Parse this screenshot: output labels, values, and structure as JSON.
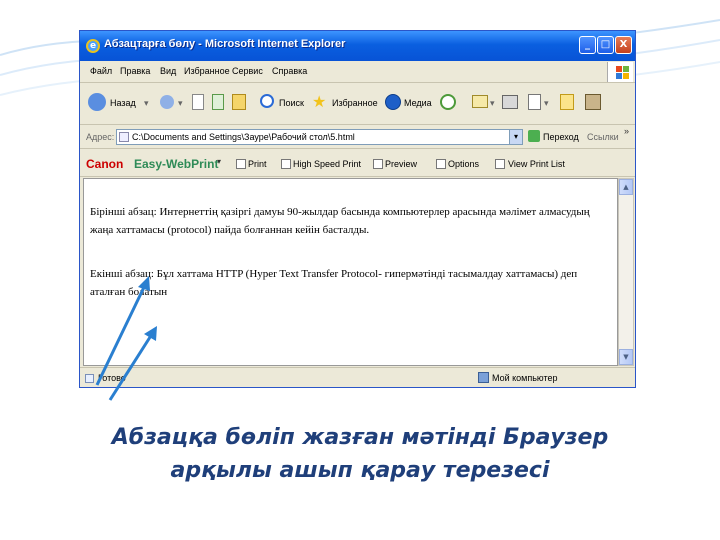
{
  "colors": {
    "caption": "#1f3f7a",
    "arrows": "#2a7fd0",
    "titlebar": "#0a5fe0"
  },
  "window": {
    "title": "Абзацтарға бөлу - Microsoft Internet Explorer",
    "icon": "ie-icon",
    "controls": [
      "_",
      "□",
      "X"
    ]
  },
  "menu": [
    "Файл",
    "Правка",
    "Вид",
    "Избранное",
    "Сервис",
    "Справка"
  ],
  "toolbar": {
    "back": "Назад",
    "search": "Поиск",
    "favorites": "Избранное",
    "media": "Медиа"
  },
  "address": {
    "label": "Адрес:",
    "value": "C:\\Documents and Settings\\Зауре\\Рабочий стол\\5.html",
    "go": "Переход",
    "links": "Ссылки"
  },
  "canon": {
    "brand": "Canon",
    "product": "Easy-WebPrint",
    "print": "Print",
    "hs_print": "High Speed Print",
    "preview": "Preview",
    "options": "Options",
    "view_list": "View Print List"
  },
  "content": {
    "paragraph1": "Бірінші абзац: Интернеттің қазіргі дамуы 90-жылдар басында компьютерлер арасында мәлімет алмасудың жаңа хаттамасы (protocol) пайда болғаннан кейін басталды.",
    "paragraph2": "Екінші абзац: Бұл хаттама HTTP (Hyper Text Transfer Protocol- гипермәтінді тасымалдау хаттамасы) деп аталған болатын"
  },
  "status": {
    "left": "Готово",
    "right": "Мой компьютер"
  },
  "caption": {
    "line1": "Абзацқа бөліп жазған мәтінді Браузер",
    "line2": "арқылы ашып қарау терезесі"
  }
}
